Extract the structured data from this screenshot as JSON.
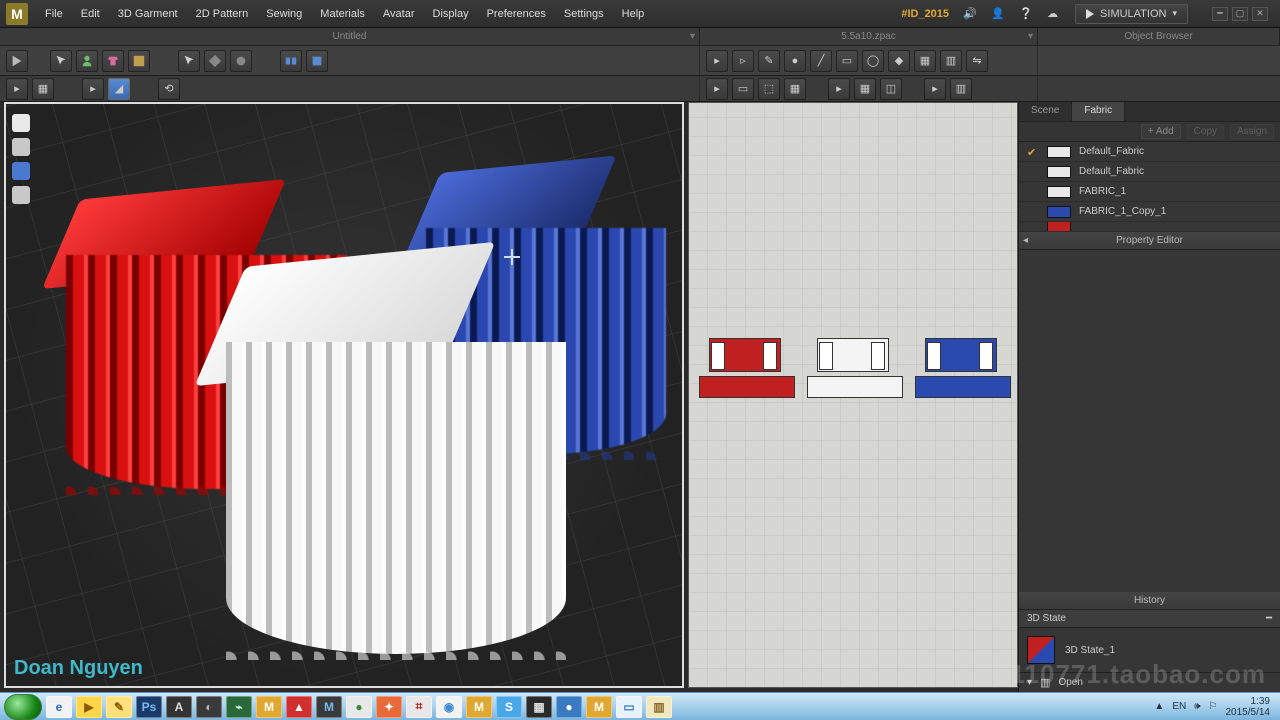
{
  "menu": {
    "items": [
      "File",
      "Edit",
      "3D Garment",
      "2D Pattern",
      "Sewing",
      "Materials",
      "Avatar",
      "Display",
      "Preferences",
      "Settings",
      "Help"
    ]
  },
  "header": {
    "badge": "#ID_2015",
    "simulation": "SIMULATION"
  },
  "titles": {
    "left": "Untitled",
    "right": "5.5a10.zpac",
    "browser": "Object Browser"
  },
  "tabs": {
    "scene": "Scene",
    "fabric": "Fabric"
  },
  "actions": {
    "add": "+ Add",
    "copy": "Copy",
    "assign": "Assign"
  },
  "fabrics": [
    {
      "name": "Default_Fabric",
      "color": "#e8e8e8",
      "checked": true
    },
    {
      "name": "Default_Fabric",
      "color": "#e8e8e8",
      "checked": false
    },
    {
      "name": "FABRIC_1",
      "color": "#e8e8e8",
      "checked": false
    },
    {
      "name": "FABRIC_1_Copy_1",
      "color": "#2a4ab0",
      "checked": false
    }
  ],
  "panels": {
    "property": "Property Editor",
    "history": "History",
    "state3d": "3D State",
    "stateItem": "3D State_1",
    "open": "Open"
  },
  "watermark": "Doan Nguyen",
  "cornerwm": "110771.taobao.com",
  "taskbar": {
    "icons": [
      {
        "bg": "#f2f2f2",
        "fg": "#2a6ac0",
        "t": "e"
      },
      {
        "bg": "#ffd54a",
        "fg": "#8a5a00",
        "t": "▶"
      },
      {
        "bg": "#ffe07a",
        "fg": "#8a5a00",
        "t": "✎"
      },
      {
        "bg": "#1a3a6a",
        "fg": "#7ab8f0",
        "t": "Ps"
      },
      {
        "bg": "#333",
        "fg": "#ddd",
        "t": "A"
      },
      {
        "bg": "#3a3a3a",
        "fg": "#bbb",
        "t": "◐"
      },
      {
        "bg": "#2a6a3a",
        "fg": "#cfe",
        "t": "⌁"
      },
      {
        "bg": "#e0a830",
        "fg": "#fff",
        "t": "M"
      },
      {
        "bg": "#d03030",
        "fg": "#fff",
        "t": "▲"
      },
      {
        "bg": "#3a3a3a",
        "fg": "#7ab8f0",
        "t": "M"
      },
      {
        "bg": "#e8e8e8",
        "fg": "#3a8a3a",
        "t": "●"
      },
      {
        "bg": "#e86a3a",
        "fg": "#fff",
        "t": "✦"
      },
      {
        "bg": "#e8e8e8",
        "fg": "#c02020",
        "t": "⌗"
      },
      {
        "bg": "#f2f2f2",
        "fg": "#3a8ad0",
        "t": "◉"
      },
      {
        "bg": "#e0a830",
        "fg": "#fff",
        "t": "M"
      },
      {
        "bg": "#4aa8e8",
        "fg": "#fff",
        "t": "S"
      },
      {
        "bg": "#2a2a2a",
        "fg": "#ddd",
        "t": "▦"
      },
      {
        "bg": "#3a7ac0",
        "fg": "#fff",
        "t": "●"
      },
      {
        "bg": "#e0a830",
        "fg": "#fff",
        "t": "M"
      },
      {
        "bg": "#e8f2fa",
        "fg": "#3a7ac0",
        "t": "▭"
      },
      {
        "bg": "#f2e8c0",
        "fg": "#8a6a2a",
        "t": "▥"
      }
    ],
    "lang": "EN",
    "time": "1:39",
    "date": "2015/5/14"
  }
}
